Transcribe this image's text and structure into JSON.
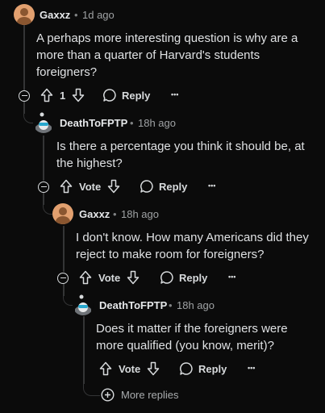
{
  "comments": [
    {
      "author": "Gaxxz",
      "time": "1d ago",
      "body": "A perhaps more interesting question is why are a more than a quarter of Harvard's students foreigners?",
      "score": "1",
      "reply_label": "Reply"
    },
    {
      "author": "DeathToFPTP",
      "time": "18h ago",
      "body": "Is there a percentage you think it should be, at the highest?",
      "score": "Vote",
      "reply_label": "Reply"
    },
    {
      "author": "Gaxxz",
      "time": "18h ago",
      "body": "I don't know. How many Americans did they reject to make room for foreigners?",
      "score": "Vote",
      "reply_label": "Reply"
    },
    {
      "author": "DeathToFPTP",
      "time": "18h ago",
      "body": "Does it matter if the foreigners were more qualified (you know, merit)?",
      "score": "Vote",
      "reply_label": "Reply"
    }
  ],
  "separator": "•",
  "more_replies_label": "More replies",
  "overflow_glyph": "•••",
  "icons": {
    "upvote": "arrow-up-icon",
    "downvote": "arrow-down-icon",
    "reply": "speech-bubble-icon",
    "collapse": "minus-circle-icon",
    "more_replies": "plus-circle-icon"
  },
  "colors": {
    "background": "#0b0b0b",
    "thread_line": "#343536",
    "gaxxz_avatar": "#e2a06f"
  }
}
